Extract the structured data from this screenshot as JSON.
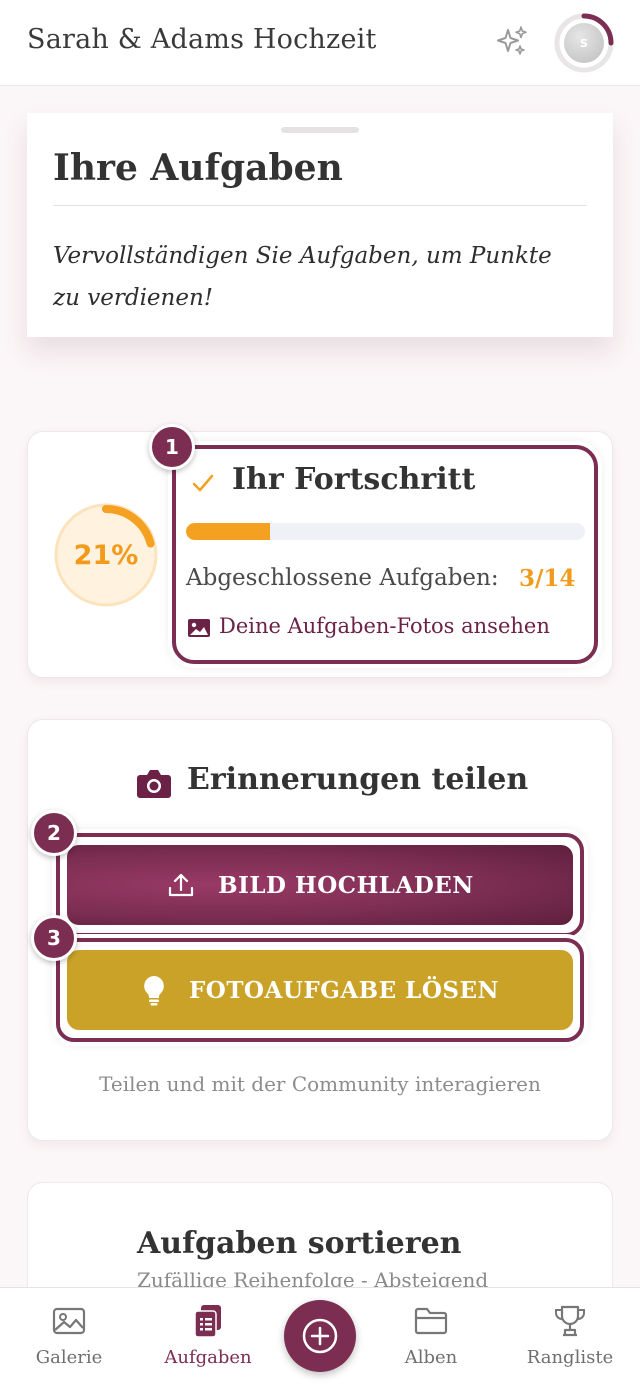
{
  "header": {
    "title": "Sarah & Adams Hochzeit",
    "sparkle_icon": "sparkles-icon",
    "avatar_initial": "S"
  },
  "intro": {
    "title": "Ihre Aufgaben",
    "text": "Vervollständigen Sie Aufgaben, um Punkte zu verdienen!"
  },
  "progress": {
    "percent_label": "21%",
    "percent": 21,
    "title": "Ihr Fortschritt",
    "completed_label": "Abgeschlossene Aufgaben:",
    "completed_value": "3/14",
    "completed_fraction": 0.21,
    "photos_link": "Deine Aufgaben-Fotos ansehen",
    "step_badge": "1"
  },
  "share": {
    "title": "Erinnerungen teilen",
    "upload_button": "BILD HOCHLADEN",
    "upload_badge": "2",
    "task_button": "FOTOAUFGABE LÖSEN",
    "task_badge": "3",
    "hint": "Teilen und mit der Community interagieren"
  },
  "sort": {
    "title": "Aufgaben sortieren",
    "subtitle": "Zufällige Reihenfolge - Absteigend"
  },
  "nav": {
    "items": [
      {
        "label": "Galerie",
        "icon": "image-icon"
      },
      {
        "label": "Aufgaben",
        "icon": "tasks-icon",
        "active": true
      },
      {
        "label": "Alben",
        "icon": "folder-icon"
      },
      {
        "label": "Rangliste",
        "icon": "trophy-icon"
      }
    ],
    "fab_icon": "plus-circle-icon"
  },
  "colors": {
    "primary": "#7b2d52",
    "accent_orange": "#f29a1a",
    "gold": "#c9a227"
  }
}
